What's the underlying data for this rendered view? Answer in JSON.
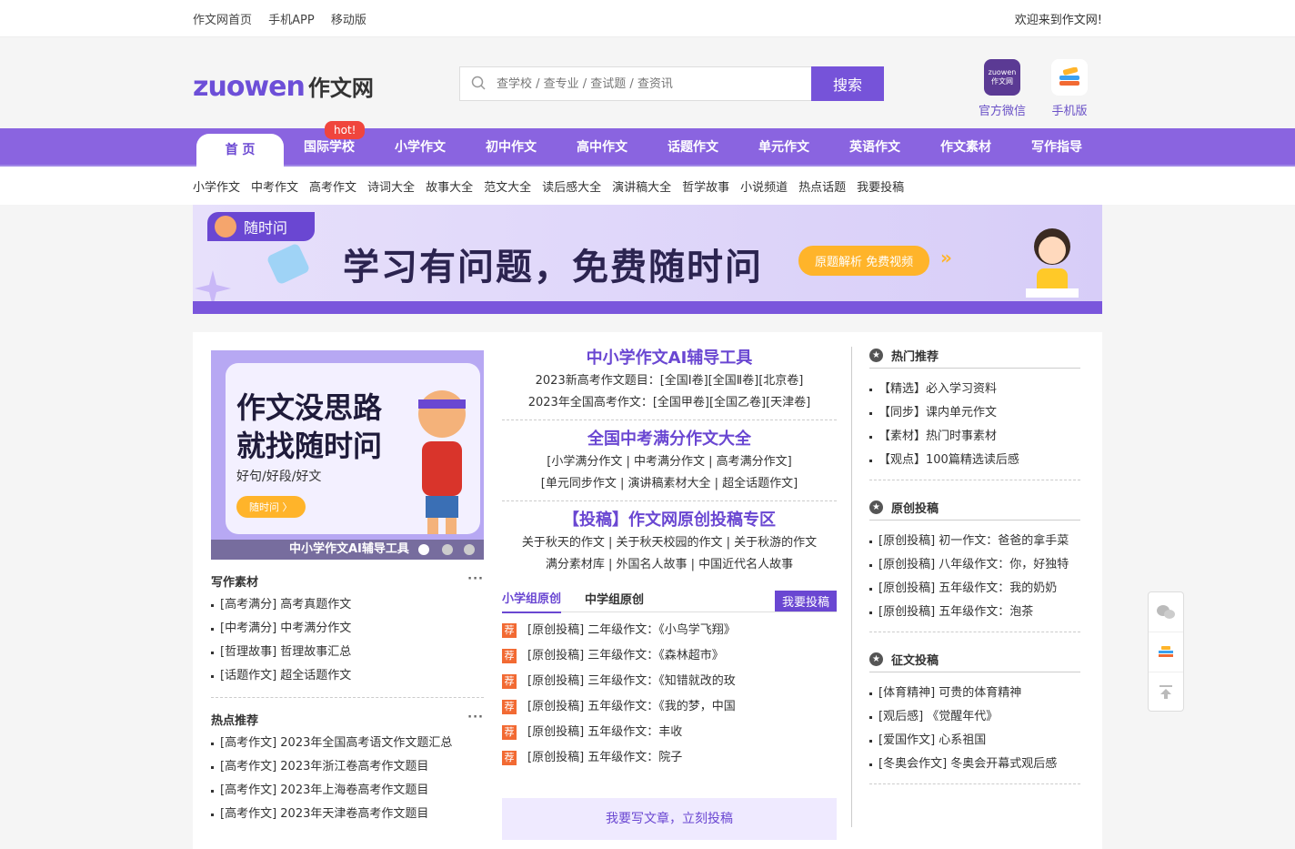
{
  "topbar": {
    "links": [
      "作文网首页",
      "手机APP",
      "移动版"
    ],
    "welcome": "欢迎来到作文网!"
  },
  "header": {
    "logo_en": "zuowen",
    "logo_cn": "作文网",
    "search_placeholder": "查学校 / 查专业 / 查试题 / 查资讯",
    "search_button": "搜索",
    "apps": [
      {
        "label": "官方微信",
        "icon": "wechat-qr-icon"
      },
      {
        "label": "手机版",
        "icon": "mobile-app-icon"
      }
    ]
  },
  "nav": {
    "items": [
      "首 页",
      "国际学校",
      "小学作文",
      "初中作文",
      "高中作文",
      "话题作文",
      "单元作文",
      "英语作文",
      "作文素材",
      "写作指导"
    ],
    "hot_badge": "hot!"
  },
  "subnav": [
    "小学作文",
    "中考作文",
    "高考作文",
    "诗词大全",
    "故事大全",
    "范文大全",
    "读后感大全",
    "演讲稿大全",
    "哲学故事",
    "小说频道",
    "热点话题",
    "我要投稿"
  ],
  "banner": {
    "tag": "随时问",
    "title": "学习有问题，免费随时问",
    "pill": "原题解析 免费视频"
  },
  "slide": {
    "line1": "作文没思路",
    "line2": "就找随时问",
    "sub": "好句/好段/好文",
    "btn": "随时问 〉",
    "caption": "中小学作文AI辅导工具"
  },
  "left": {
    "sections": [
      {
        "title": "写作素材",
        "more": "···",
        "items": [
          "[高考满分] 高考真题作文",
          "[中考满分] 中考满分作文",
          "[哲理故事] 哲理故事汇总",
          "[话题作文] 超全话题作文"
        ]
      },
      {
        "title": "热点推荐",
        "more": "···",
        "items": [
          "[高考作文] 2023年全国高考语文作文题汇总",
          "[高考作文] 2023年浙江卷高考作文题目",
          "[高考作文] 2023年上海卷高考作文题目",
          "[高考作文] 2023年天津卷高考作文题目"
        ]
      }
    ]
  },
  "center": {
    "blocks": [
      {
        "title": "中小学作文AI辅导工具",
        "lines": [
          "2023新高考作文题目：[全国Ⅰ卷][全国Ⅱ卷][北京卷]",
          "2023年全国高考作文：[全国甲卷][全国乙卷][天津卷]"
        ]
      },
      {
        "title": "全国中考满分作文大全",
        "lines": [
          "[小学满分作文 | 中考满分作文 | 高考满分作文]",
          "[单元同步作文 | 演讲稿素材大全 | 超全话题作文]"
        ]
      },
      {
        "title": "【投稿】作文网原创投稿专区",
        "lines": [
          "关于秋天的作文 | 关于秋天校园的作文 | 关于秋游的作文",
          "满分素材库 | 外国名人故事 | 中国近代名人故事"
        ]
      }
    ],
    "tabs": [
      "小学组原创",
      "中学组原创"
    ],
    "tab_button": "我要投稿",
    "badge": "荐",
    "list": [
      "[原创投稿] 二年级作文：《小鸟学飞翔》",
      "[原创投稿] 三年级作文：《森林超市》",
      "[原创投稿] 三年级作文：《知错就改的玫",
      "[原创投稿] 五年级作文：《我的梦，中国",
      "[原创投稿] 五年级作文：丰收",
      "[原创投稿] 五年级作文：院子"
    ],
    "bottom_banner": "我要写文章，立刻投稿"
  },
  "right": {
    "sections": [
      {
        "title": "热门推荐",
        "items": [
          "【精选】必入学习资料",
          "【同步】课内单元作文",
          "【素材】热门时事素材",
          "【观点】100篇精选读后感"
        ]
      },
      {
        "title": "原创投稿",
        "items": [
          "[原创投稿] 初一作文：爸爸的拿手菜",
          "[原创投稿] 八年级作文：你，好独特",
          "[原创投稿] 五年级作文：我的奶奶",
          "[原创投稿] 五年级作文：泡茶"
        ]
      },
      {
        "title": "征文投稿",
        "items": [
          "[体育精神] 可贵的体育精神",
          "[观后感] 《觉醒年代》",
          "[爱国作文] 心系祖国",
          "[冬奥会作文] 冬奥会开幕式观后感"
        ]
      }
    ]
  },
  "colors": {
    "accent": "#7653d9",
    "nav": "#8a64e0",
    "hot": "#f0453d",
    "badge": "#f26a33",
    "pill": "#ffb42a"
  }
}
